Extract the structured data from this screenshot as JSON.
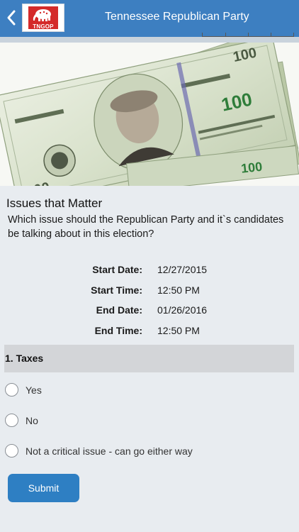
{
  "header": {
    "title": "Tennessee Republican Party",
    "logo_text": "TNGOP",
    "back_icon": "chevron-left-icon"
  },
  "hero": {
    "bill_value": "100"
  },
  "poll": {
    "title": "Issues that Matter",
    "question": "Which issue should the Republican Party and it`s candidates be talking about in this election?",
    "schedule": [
      {
        "label": "Start Date:",
        "value": "12/27/2015"
      },
      {
        "label": "Start Time:",
        "value": "12:50 PM"
      },
      {
        "label": "End Date:",
        "value": "01/26/2016"
      },
      {
        "label": "End Time:",
        "value": "12:50 PM"
      }
    ],
    "question_1": {
      "label": "1. Taxes",
      "options": [
        "Yes",
        "No",
        "Not a critical issue - can go either way"
      ]
    },
    "submit_label": "Submit"
  },
  "colors": {
    "header": "#3d7fc1",
    "button": "#2e7fc3",
    "background": "#e8ecf0",
    "question_bar": "#d3d5d8",
    "logo_red": "#d42a2a"
  }
}
